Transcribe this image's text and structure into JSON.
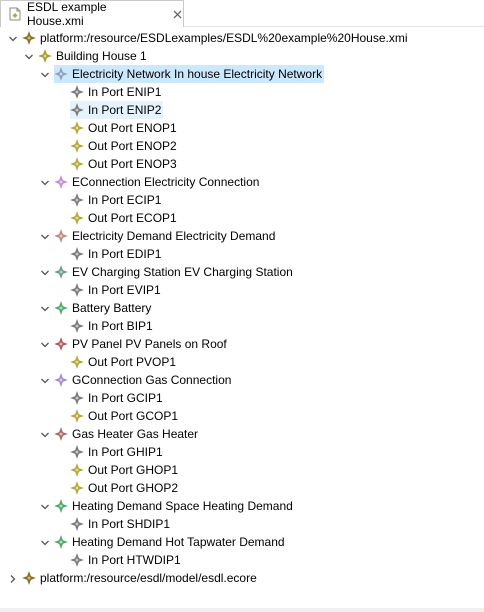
{
  "editor": {
    "tab_label": "ESDL example House.xmi",
    "tab_icon": "xmi-file-icon",
    "close_icon": "close-tab-icon"
  },
  "tree": {
    "nodes": [
      {
        "label": "platform:/resource/ESDLexamples/ESDL%20example%20House.xmi",
        "depth": 0,
        "state": "expanded",
        "icon": "resource-icon",
        "color": "#8a6d1e"
      },
      {
        "label": "Building House 1",
        "depth": 1,
        "state": "expanded",
        "icon": "building-icon",
        "color": "#a99a2a"
      },
      {
        "label": "Electricity Network In house Electricity Network",
        "depth": 2,
        "state": "expanded",
        "icon": "asset-icon",
        "color": "#8aa3b8",
        "selected": true
      },
      {
        "label": "In Port ENIP1",
        "depth": 3,
        "state": "leaf",
        "icon": "in-port-icon",
        "color": "#7a7a7a"
      },
      {
        "label": "In Port ENIP2",
        "depth": 3,
        "state": "leaf",
        "icon": "in-port-icon",
        "color": "#7a7a7a",
        "hover": true
      },
      {
        "label": "Out Port ENOP1",
        "depth": 3,
        "state": "leaf",
        "icon": "out-port-icon",
        "color": "#b5a83a"
      },
      {
        "label": "Out Port ENOP2",
        "depth": 3,
        "state": "leaf",
        "icon": "out-port-icon",
        "color": "#b5a83a"
      },
      {
        "label": "Out Port ENOP3",
        "depth": 3,
        "state": "leaf",
        "icon": "out-port-icon",
        "color": "#b5a83a"
      },
      {
        "label": "EConnection Electricity Connection",
        "depth": 2,
        "state": "expanded",
        "icon": "asset-icon",
        "color": "#c58ad0"
      },
      {
        "label": "In Port ECIP1",
        "depth": 3,
        "state": "leaf",
        "icon": "in-port-icon",
        "color": "#7a7a7a"
      },
      {
        "label": "Out Port ECOP1",
        "depth": 3,
        "state": "leaf",
        "icon": "out-port-icon",
        "color": "#b5a83a"
      },
      {
        "label": "Electricity Demand Electricity Demand",
        "depth": 2,
        "state": "expanded",
        "icon": "asset-icon",
        "color": "#c08a7a"
      },
      {
        "label": "In Port EDIP1",
        "depth": 3,
        "state": "leaf",
        "icon": "in-port-icon",
        "color": "#7a7a7a"
      },
      {
        "label": "EV Charging Station EV Charging Station",
        "depth": 2,
        "state": "expanded",
        "icon": "asset-icon",
        "color": "#6b9a8a"
      },
      {
        "label": "In Port EVIP1",
        "depth": 3,
        "state": "leaf",
        "icon": "in-port-icon",
        "color": "#7a7a7a"
      },
      {
        "label": "Battery Battery",
        "depth": 2,
        "state": "expanded",
        "icon": "asset-icon",
        "color": "#4fa86a"
      },
      {
        "label": "In Port BIP1",
        "depth": 3,
        "state": "leaf",
        "icon": "in-port-icon",
        "color": "#7a7a7a"
      },
      {
        "label": "PV Panel PV Panels on Roof",
        "depth": 2,
        "state": "expanded",
        "icon": "asset-icon",
        "color": "#b05a5a"
      },
      {
        "label": "Out Port PVOP1",
        "depth": 3,
        "state": "leaf",
        "icon": "out-port-icon",
        "color": "#b5a83a"
      },
      {
        "label": "GConnection Gas Connection",
        "depth": 2,
        "state": "expanded",
        "icon": "asset-icon",
        "color": "#a58ad0"
      },
      {
        "label": "In Port GCIP1",
        "depth": 3,
        "state": "leaf",
        "icon": "in-port-icon",
        "color": "#7a7a7a"
      },
      {
        "label": "Out Port GCOP1",
        "depth": 3,
        "state": "leaf",
        "icon": "out-port-icon",
        "color": "#b5a83a"
      },
      {
        "label": "Gas Heater Gas Heater",
        "depth": 2,
        "state": "expanded",
        "icon": "asset-icon",
        "color": "#a86a6a"
      },
      {
        "label": "In Port GHIP1",
        "depth": 3,
        "state": "leaf",
        "icon": "in-port-icon",
        "color": "#7a7a7a"
      },
      {
        "label": "Out Port GHOP1",
        "depth": 3,
        "state": "leaf",
        "icon": "out-port-icon",
        "color": "#b5a83a"
      },
      {
        "label": "Out Port GHOP2",
        "depth": 3,
        "state": "leaf",
        "icon": "out-port-icon",
        "color": "#b5a83a"
      },
      {
        "label": "Heating Demand Space Heating Demand",
        "depth": 2,
        "state": "expanded",
        "icon": "asset-icon",
        "color": "#4fa86a"
      },
      {
        "label": "In Port SHDIP1",
        "depth": 3,
        "state": "leaf",
        "icon": "in-port-icon",
        "color": "#7a7a7a"
      },
      {
        "label": "Heating Demand Hot Tapwater Demand",
        "depth": 2,
        "state": "expanded",
        "icon": "asset-icon",
        "color": "#4fa86a"
      },
      {
        "label": "In Port HTWDIP1",
        "depth": 3,
        "state": "leaf",
        "icon": "in-port-icon",
        "color": "#7a7a7a"
      },
      {
        "label": "platform:/resource/esdl/model/esdl.ecore",
        "depth": 0,
        "state": "collapsed",
        "icon": "resource-icon",
        "color": "#8a6d1e"
      }
    ]
  },
  "colors": {
    "selection": "#cce8ff",
    "hover": "#e5f3ff",
    "arrow": "#555555"
  }
}
